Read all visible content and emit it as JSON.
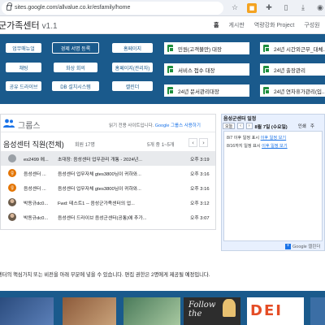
{
  "browser": {
    "url": "sites.google.com/allvalue.co.kr/esfamily/home"
  },
  "site": {
    "title": "군가족센터",
    "version": "v1.1",
    "nav": [
      "홈",
      "게시판",
      "역량강화 Project",
      "구성원"
    ]
  },
  "quick_buttons": {
    "col1": [
      "업무매뉴얼",
      "채팅",
      "공유 드라이브"
    ],
    "col2": [
      "경제 서명 등록",
      "화상 회의",
      "DB 설치시스템"
    ],
    "col3": [
      "홈페이지",
      "홈페이지(관리자)",
      "캘린더"
    ],
    "selected": "경제 서명 등록"
  },
  "sheet_cards": {
    "left": [
      "민원(고객불만) 대장",
      "서비스 접수 대장",
      "24년 문서관리대장"
    ],
    "right": [
      "24년 시간외근무_대체...",
      "24년 출장관리",
      "24년 연차휴가관리(입..."
    ]
  },
  "groups": {
    "heading": "그룹스",
    "note_prefix": "읽기 전용 사이트입니다.",
    "note_link": "Google 그룹스 사용하기",
    "group_name": "음성센터 직원(전체)",
    "members": "회원 17명",
    "range": "5개 중 1~5개",
    "rows": [
      {
        "author": "es2499 에...",
        "subject": "초대장: 음성센터 업무관리 개통 - 2024년...",
        "time": "오후 3:19"
      },
      {
        "author": "음성센터 ...",
        "subject": "음성센터 업무자체 gtes3800님이 귀하와...",
        "time": "오후 3:16"
      },
      {
        "author": "음성센터 ...",
        "subject": "음성센터 업무자체 gtes3800님이 귀하와...",
        "time": "오후 3:16"
      },
      {
        "author": "박동규dc0...",
        "subject": "Fwd: 테스트1 -- 음성군가족센터의 업...",
        "time": "오후 3:12"
      },
      {
        "author": "박동규dc0...",
        "subject": "음성센터 드라이브 음성군센터(공통)에 추가...",
        "time": "오후 3:07"
      }
    ]
  },
  "calendar": {
    "title": "음성군센터 일정",
    "today_label": "오늘",
    "date": "8월 7일 (수요일)",
    "print_label": "인쇄",
    "week_label": "주",
    "events": [
      {
        "prefix": "8/7 이후 일정 표시",
        "link": "이후 일정 보기"
      },
      {
        "prefix": "8/16까지 일정 표시",
        "link": "이후 일정 보기"
      }
    ],
    "footer_brand": "Google 캘린더"
  },
  "description": "센터의 핵심가치 또는 비전을 아래 부분에 넣을 수 있습니다. 편집 권한은 2명에게 제공될 예정입니다.",
  "thumb_text": [
    "Follow",
    "the"
  ],
  "thumb_logo": "DEI",
  "colors": {
    "brand_blue": "#1a5a8c",
    "sheet_green": "#1e8e3e",
    "link_blue": "#1a73e8"
  }
}
